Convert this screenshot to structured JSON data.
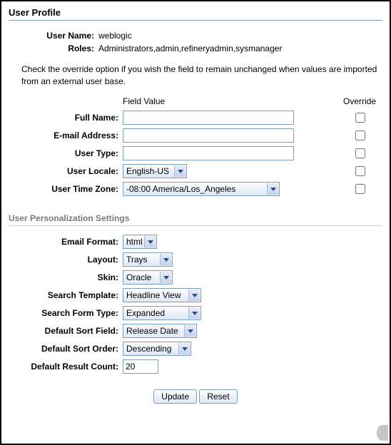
{
  "page": {
    "title": "User Profile"
  },
  "info": {
    "username_label": "User Name:",
    "username_value": "weblogic",
    "roles_label": "Roles:",
    "roles_value": "Administrators,admin,refineryadmin,sysmanager"
  },
  "instruction": "Check the override option if you wish the field to remain unchanged when values are imported from an external user base.",
  "headers": {
    "field_value": "Field Value",
    "override": "Override"
  },
  "fields": {
    "full_name": {
      "label": "Full Name:",
      "value": ""
    },
    "email": {
      "label": "E-mail Address:",
      "value": ""
    },
    "user_type": {
      "label": "User Type:",
      "value": ""
    },
    "locale": {
      "label": "User Locale:",
      "value": "English-US"
    },
    "timezone": {
      "label": "User Time Zone:",
      "value": "-08:00 America/Los_Angeles"
    }
  },
  "personalization": {
    "section_title": "User Personalization Settings",
    "email_format": {
      "label": "Email Format:",
      "value": "html"
    },
    "layout": {
      "label": "Layout:",
      "value": "Trays"
    },
    "skin": {
      "label": "Skin:",
      "value": "Oracle"
    },
    "search_template": {
      "label": "Search Template:",
      "value": "Headline View"
    },
    "search_form_type": {
      "label": "Search Form Type:",
      "value": "Expanded"
    },
    "default_sort_field": {
      "label": "Default Sort Field:",
      "value": "Release Date"
    },
    "default_sort_order": {
      "label": "Default Sort Order:",
      "value": "Descending"
    },
    "default_result_count": {
      "label": "Default Result Count:",
      "value": "20"
    }
  },
  "buttons": {
    "update": "Update",
    "reset": "Reset"
  }
}
